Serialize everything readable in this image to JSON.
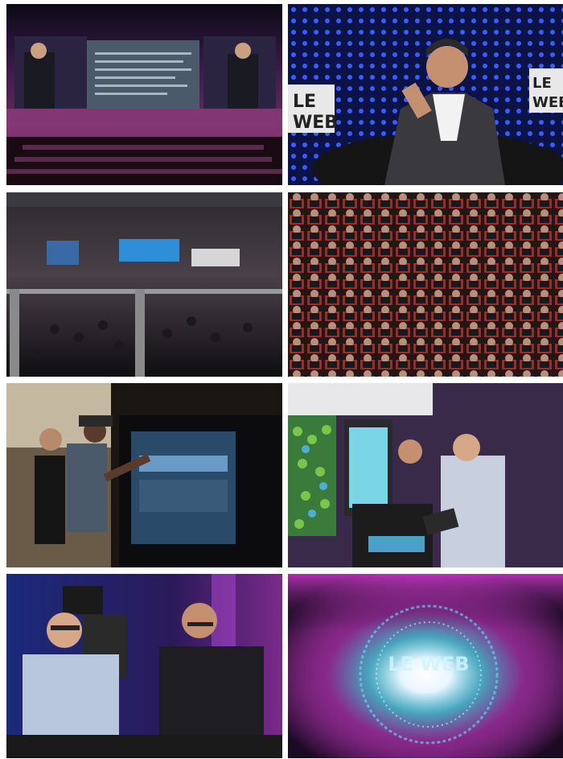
{
  "collage": {
    "photos": [
      {
        "name": "main-stage-photo",
        "subject": "conference main stage with large screens"
      },
      {
        "name": "speaker-portrait-photo",
        "subject": "speaker seated on stage in front of LE WEB sign",
        "sign_text": [
          "LE",
          "WEB"
        ],
        "sign_text_right": [
          "LE",
          "WEB"
        ]
      },
      {
        "name": "exhibition-hall-photo",
        "subject": "exhibition hall with crowd and stands"
      },
      {
        "name": "audience-photo",
        "subject": "seated audience in red chairs"
      },
      {
        "name": "touchscreen-demo-photo",
        "subject": "two men at large touchscreen wall"
      },
      {
        "name": "tablet-demo-photo",
        "subject": "two men with tablet at demo stand"
      },
      {
        "name": "interview-photo",
        "subject": "two men seated on stage wearing glasses, camera operator"
      },
      {
        "name": "le-web-logo-photo",
        "subject": "LE WEB logo with light burst",
        "logo_text": "LE WEB"
      }
    ],
    "colors": {
      "stage_purple": "#7a2a8a",
      "stage_blue": "#1b2a7a",
      "dot_blue": "#3a5cff",
      "seat_red": "#b0342a",
      "logo_magenta": "#d23cd0",
      "logo_cyan": "#59e6ff"
    }
  }
}
